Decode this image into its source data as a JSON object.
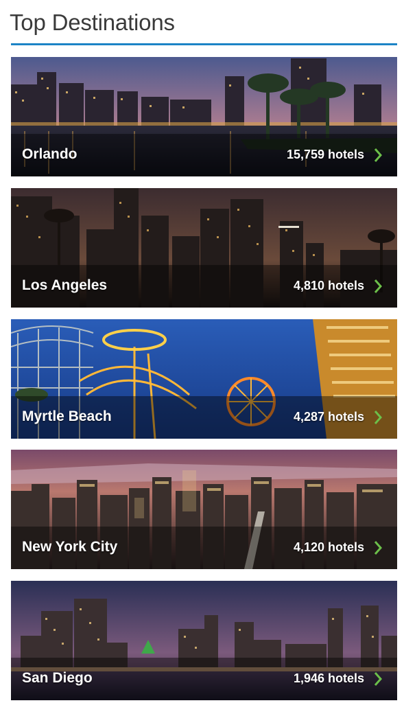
{
  "header": {
    "title": "Top Destinations"
  },
  "destinations": [
    {
      "city": "Orlando",
      "hotels": "15,759 hotels"
    },
    {
      "city": "Los Angeles",
      "hotels": "4,810 hotels"
    },
    {
      "city": "Myrtle Beach",
      "hotels": "4,287 hotels"
    },
    {
      "city": "New York City",
      "hotels": "4,120 hotels"
    },
    {
      "city": "San Diego",
      "hotels": "1,946 hotels"
    }
  ],
  "colors": {
    "accent_rule": "#1c84c6",
    "chevron": "#6cc04a"
  },
  "icons": {
    "card_arrow": "chevron-right-icon"
  }
}
